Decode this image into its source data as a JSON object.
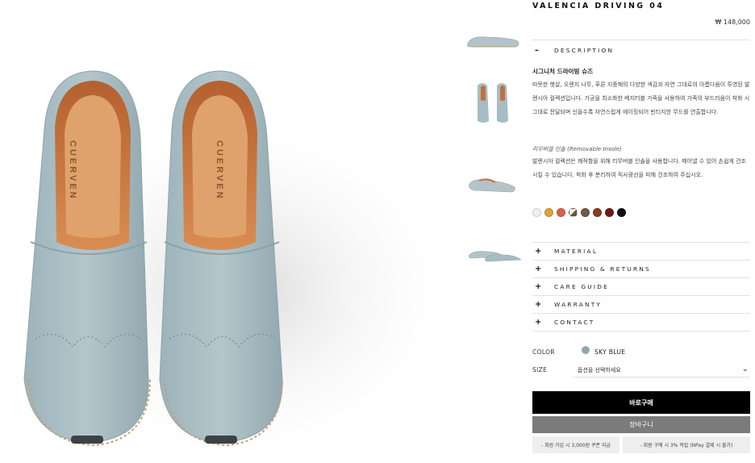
{
  "product": {
    "title": "VALENCIA DRIVING 04",
    "price": "₩ 148,000"
  },
  "description": {
    "toggle": "–",
    "label": "DESCRIPTION",
    "heading": "시그니처 드라이빙 슈즈",
    "body": "따뜻한 햇살, 오렌지 나무, 푸른 지중해의 다양한 색감과 자연 그대로의 아름다움이 투영된 발렌시아 컬렉션입니다. 가공을 최소화한 베지터블 가죽을 사용하여 가죽의 부드러움이 착화 시 그대로 전달되며 신을수록 자연스럽게 에이징되어 빈티지한 무드를 연출합니다.",
    "insole_heading": "리무버블 인솔 (Removable Insole)",
    "insole_body": "발렌시아 컬렉션은 쾌적함을 위해 리무버블 인솔을 사용합니다. 떼어낼 수 있어 손쉽게 건조시킬 수 있습니다. 착화 후 분리하여 직사광선을 피해 건조하여 주십시오."
  },
  "swatches": [
    {
      "name": "white",
      "color": "#f2f0ea"
    },
    {
      "name": "mustard",
      "color": "#e0a23a"
    },
    {
      "name": "coral",
      "color": "#d9604a"
    },
    {
      "name": "two-tone",
      "color": "#6b5140"
    },
    {
      "name": "olive-brown",
      "color": "#6e5a47"
    },
    {
      "name": "rust",
      "color": "#8a3a20"
    },
    {
      "name": "burgundy",
      "color": "#6e1a1a"
    },
    {
      "name": "black",
      "color": "#111111"
    }
  ],
  "accordion": [
    {
      "sign": "+",
      "label": "MATERIAL"
    },
    {
      "sign": "+",
      "label": "SHIPPING & RETURNS"
    },
    {
      "sign": "+",
      "label": "CARE GUIDE"
    },
    {
      "sign": "+",
      "label": "WARRANTY"
    },
    {
      "sign": "+",
      "label": "CONTACT"
    }
  ],
  "options": {
    "color_label": "COLOR",
    "color_value": "SKY BLUE",
    "color_hex": "#8fa9b3",
    "size_label": "SIZE",
    "size_placeholder": "옵션을 선택하세요"
  },
  "buttons": {
    "buy": "바로구매",
    "cart": "장바구니"
  },
  "benefits": [
    "- 회원 가입 시 3,000원 쿠폰 지급",
    "- 회원 구매 시 3% 적립 (NPay 결제 시 불가)"
  ],
  "gallery": {
    "brand_mark": "CUERVEN",
    "shoe_color": "#a7bcc3",
    "lining_color": "#c2703d"
  }
}
